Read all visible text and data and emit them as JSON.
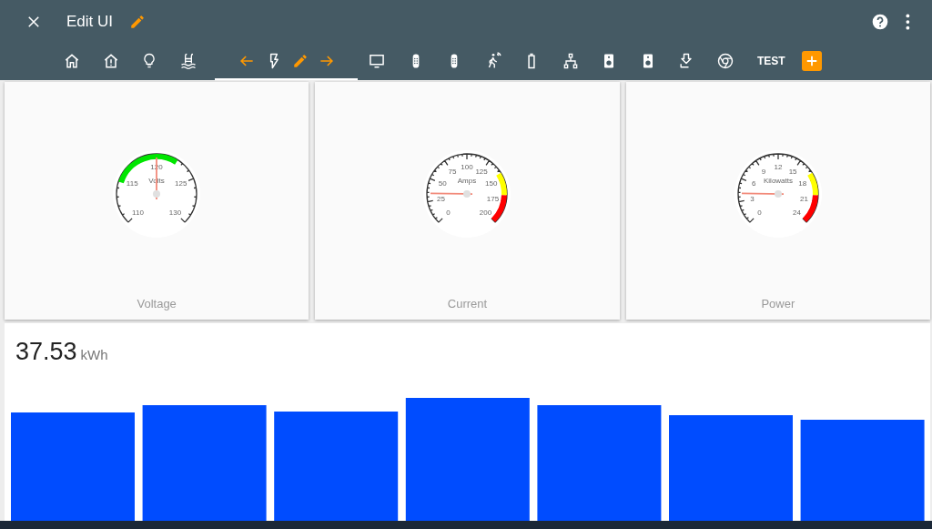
{
  "header": {
    "title": "Edit UI",
    "tabs": [
      {
        "kind": "icon",
        "selected": false
      },
      {
        "kind": "icon",
        "selected": false
      },
      {
        "kind": "icon",
        "selected": false
      },
      {
        "kind": "icon",
        "selected": false
      },
      {
        "kind": "edit",
        "selected": true
      },
      {
        "kind": "icon",
        "selected": false
      },
      {
        "kind": "icon",
        "selected": false
      },
      {
        "kind": "icon",
        "selected": false
      },
      {
        "kind": "icon",
        "selected": false
      },
      {
        "kind": "icon",
        "selected": false
      },
      {
        "kind": "icon",
        "selected": false
      },
      {
        "kind": "icon",
        "selected": false
      },
      {
        "kind": "icon",
        "selected": false
      },
      {
        "kind": "icon",
        "selected": false
      },
      {
        "kind": "icon",
        "selected": false
      },
      {
        "kind": "text",
        "label": "TEST",
        "selected": false
      },
      {
        "kind": "add",
        "selected": false
      }
    ]
  },
  "gauges": [
    {
      "title": "Voltage",
      "unit": "Volts",
      "kind": "center-band",
      "labels": [
        "110",
        "115",
        "120",
        "125",
        "130"
      ],
      "level": 0.5
    },
    {
      "title": "Current",
      "unit": "Amps",
      "kind": "high-warning",
      "labels": [
        "0",
        "25",
        "50",
        "75",
        "100",
        "125",
        "150",
        "175",
        "200"
      ],
      "level": 0.17
    },
    {
      "title": "Power",
      "unit": "Kilowatts",
      "kind": "high-warning",
      "labels": [
        "0",
        "3",
        "6",
        "9",
        "12",
        "15",
        "18",
        "21",
        "24"
      ],
      "level": 0.17
    }
  ],
  "energy": {
    "value": "37.53",
    "unit": "kWh"
  }
}
